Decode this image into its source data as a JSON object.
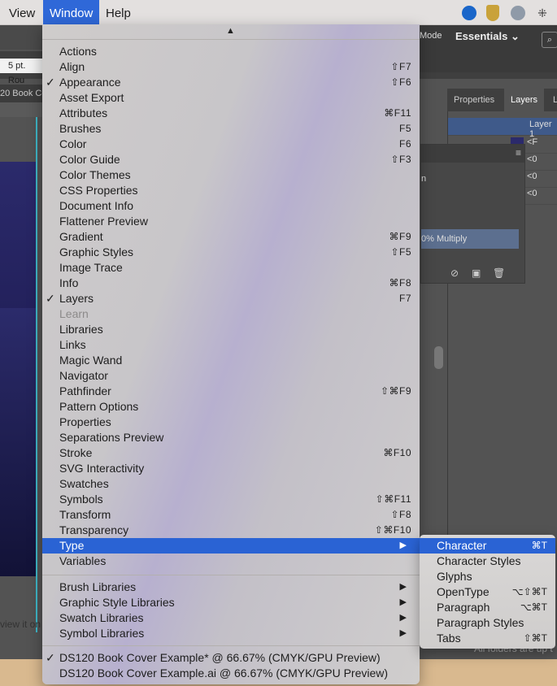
{
  "menubar": {
    "items": [
      "View",
      "Window",
      "Help"
    ],
    "active": "Window"
  },
  "app": {
    "stroke_value": "5 pt. Rou",
    "doc_tab": "20 Book Co",
    "mode_label": "Mode",
    "workspace": "Essentials",
    "panel_tabs": [
      "Properties",
      "Layers",
      "L"
    ],
    "layer_name": "Layer 1",
    "layer_children": [
      "<F",
      "<0",
      "<0",
      "<0"
    ],
    "float_panel_options": [
      "n",
      "0% Multiply"
    ],
    "status_text": "view it on",
    "folder_note": "All folders are up t"
  },
  "window_menu": {
    "scroll_up": "▲",
    "groups": [
      [
        {
          "label": "Actions",
          "shortcut": ""
        },
        {
          "label": "Align",
          "shortcut": "⇧F7"
        },
        {
          "label": "Appearance",
          "shortcut": "⇧F6",
          "checked": true
        },
        {
          "label": "Asset Export",
          "shortcut": ""
        },
        {
          "label": "Attributes",
          "shortcut": "⌘F11"
        },
        {
          "label": "Brushes",
          "shortcut": "F5"
        },
        {
          "label": "Color",
          "shortcut": "F6"
        },
        {
          "label": "Color Guide",
          "shortcut": "⇧F3"
        },
        {
          "label": "Color Themes",
          "shortcut": ""
        },
        {
          "label": "CSS Properties",
          "shortcut": ""
        },
        {
          "label": "Document Info",
          "shortcut": ""
        },
        {
          "label": "Flattener Preview",
          "shortcut": ""
        },
        {
          "label": "Gradient",
          "shortcut": "⌘F9"
        },
        {
          "label": "Graphic Styles",
          "shortcut": "⇧F5"
        },
        {
          "label": "Image Trace",
          "shortcut": ""
        },
        {
          "label": "Info",
          "shortcut": "⌘F8"
        },
        {
          "label": "Layers",
          "shortcut": "F7",
          "checked": true
        },
        {
          "label": "Learn",
          "shortcut": "",
          "disabled": true
        },
        {
          "label": "Libraries",
          "shortcut": ""
        },
        {
          "label": "Links",
          "shortcut": ""
        },
        {
          "label": "Magic Wand",
          "shortcut": ""
        },
        {
          "label": "Navigator",
          "shortcut": ""
        },
        {
          "label": "Pathfinder",
          "shortcut": "⇧⌘F9"
        },
        {
          "label": "Pattern Options",
          "shortcut": ""
        },
        {
          "label": "Properties",
          "shortcut": ""
        },
        {
          "label": "Separations Preview",
          "shortcut": ""
        },
        {
          "label": "Stroke",
          "shortcut": "⌘F10"
        },
        {
          "label": "SVG Interactivity",
          "shortcut": ""
        },
        {
          "label": "Swatches",
          "shortcut": ""
        },
        {
          "label": "Symbols",
          "shortcut": "⇧⌘F11"
        },
        {
          "label": "Transform",
          "shortcut": "⇧F8"
        },
        {
          "label": "Transparency",
          "shortcut": "⇧⌘F10"
        },
        {
          "label": "Type",
          "shortcut": "",
          "submenu": true,
          "highlighted": true
        },
        {
          "label": "Variables",
          "shortcut": ""
        }
      ],
      [
        {
          "label": "Brush Libraries",
          "submenu": true
        },
        {
          "label": "Graphic Style Libraries",
          "submenu": true
        },
        {
          "label": "Swatch Libraries",
          "submenu": true
        },
        {
          "label": "Symbol Libraries",
          "submenu": true
        }
      ],
      [
        {
          "label": "DS120 Book Cover Example* @ 66.67% (CMYK/GPU Preview)",
          "checked": true
        },
        {
          "label": "DS120 Book Cover Example.ai @ 66.67% (CMYK/GPU Preview)"
        }
      ]
    ]
  },
  "type_submenu": [
    {
      "label": "Character",
      "shortcut": "⌘T",
      "highlighted": true
    },
    {
      "label": "Character Styles",
      "shortcut": ""
    },
    {
      "label": "Glyphs",
      "shortcut": ""
    },
    {
      "label": "OpenType",
      "shortcut": "⌥⇧⌘T"
    },
    {
      "label": "Paragraph",
      "shortcut": "⌥⌘T"
    },
    {
      "label": "Paragraph Styles",
      "shortcut": ""
    },
    {
      "label": "Tabs",
      "shortcut": "⇧⌘T"
    }
  ],
  "colors": {
    "highlight": "#2a63d4",
    "menubar_active": "#2f68d8",
    "guide": "#3fb7c9"
  }
}
